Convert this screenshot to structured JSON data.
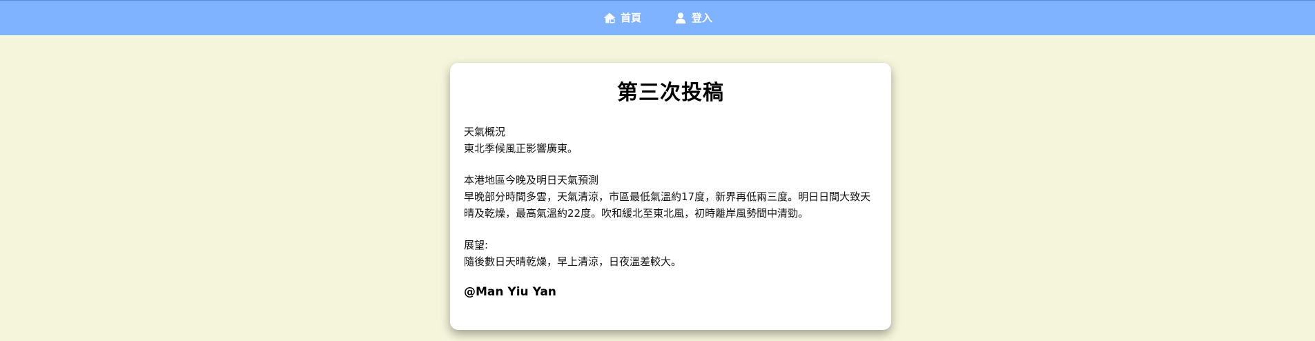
{
  "nav": {
    "home": {
      "label": "首頁",
      "icon": "home-icon"
    },
    "login": {
      "label": "登入",
      "icon": "user-icon"
    }
  },
  "post": {
    "title": "第三次投稿",
    "section1_heading": "天氣概況",
    "section1_text": "東北季候風正影響廣東。",
    "section2_heading": "本港地區今晚及明日天氣預測",
    "section2_text": "早晚部分時間多雲，天氣清涼，市區最低氣溫約17度，新界再低兩三度。明日日間大致天晴及乾燥，最高氣溫約22度。吹和緩北至東北風，初時離岸風勢間中清勁。",
    "section3_heading": "展望:",
    "section3_text": "隨後數日天晴乾燥，早上清涼，日夜溫差較大。",
    "author": "@Man Yiu Yan"
  },
  "colors": {
    "navbar": "#7fb3ff",
    "page_background": "#f5f5dc",
    "card_background": "#ffffff"
  }
}
